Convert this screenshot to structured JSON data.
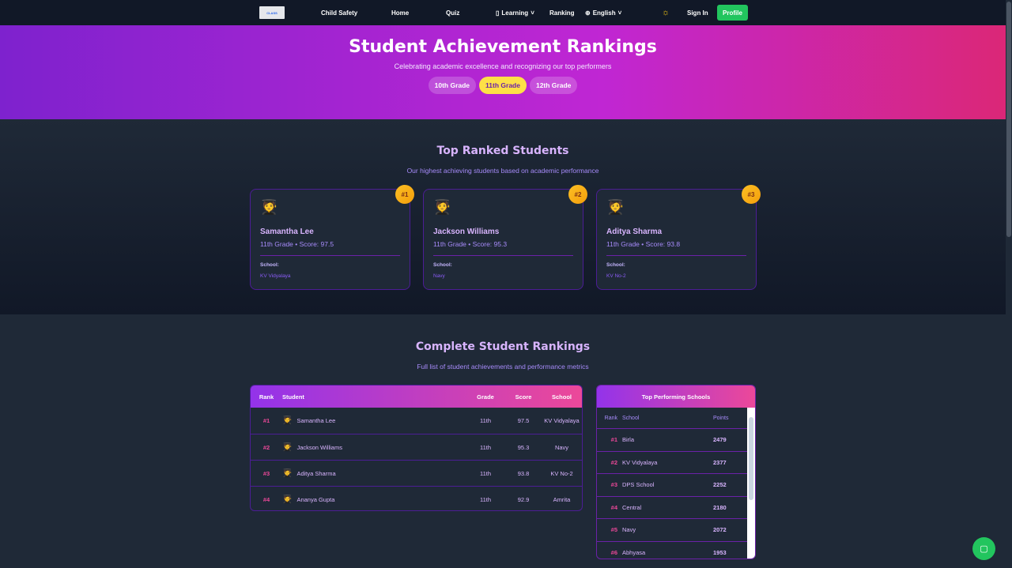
{
  "nav": {
    "logo_text": "CLASS",
    "items": [
      "Child Safety",
      "Home",
      "Quiz",
      "Learning",
      "Ranking",
      "English"
    ],
    "sign_in": "Sign In",
    "profile": "Profile"
  },
  "hero": {
    "title": "Student Achievement Rankings",
    "subtitle": "Celebrating academic excellence and recognizing our top performers",
    "grades": [
      "10th Grade",
      "11th Grade",
      "12th Grade"
    ],
    "active_grade": "11th Grade"
  },
  "top": {
    "title": "Top Ranked Students",
    "subtitle": "Our highest achieving students based on academic performance",
    "school_label": "School:",
    "cards": [
      {
        "rank": "#1",
        "emoji": "🧑‍🎓",
        "name": "Samantha Lee",
        "detail": "11th Grade • Score: 97.5",
        "school": "KV Vidyalaya"
      },
      {
        "rank": "#2",
        "emoji": "🧑‍🎓",
        "name": "Jackson Williams",
        "detail": "11th Grade • Score: 95.3",
        "school": "Navy"
      },
      {
        "rank": "#3",
        "emoji": "🧑‍🎓",
        "name": "Aditya Sharma",
        "detail": "11th Grade • Score: 93.8",
        "school": "KV No-2"
      }
    ]
  },
  "complete": {
    "title": "Complete Student Rankings",
    "subtitle": "Full list of student achievements and performance metrics",
    "headers": {
      "rank": "Rank",
      "student": "Student",
      "grade": "Grade",
      "score": "Score",
      "school": "School"
    },
    "rows": [
      {
        "rank": "#1",
        "name": "Samantha Lee",
        "grade": "11th",
        "score": "97.5",
        "school": "KV Vidyalaya"
      },
      {
        "rank": "#2",
        "name": "Jackson Williams",
        "grade": "11th",
        "score": "95.3",
        "school": "Navy"
      },
      {
        "rank": "#3",
        "name": "Aditya Sharma",
        "grade": "11th",
        "score": "93.8",
        "school": "KV No-2"
      },
      {
        "rank": "#4",
        "name": "Ananya Gupta",
        "grade": "11th",
        "score": "92.9",
        "school": "Amrita"
      }
    ]
  },
  "schools": {
    "title": "Top Performing Schools",
    "headers": {
      "rank": "Rank",
      "school": "School",
      "points": "Points"
    },
    "rows": [
      {
        "rank": "#1",
        "school": "Birla",
        "points": "2479"
      },
      {
        "rank": "#2",
        "school": "KV Vidyalaya",
        "points": "2377"
      },
      {
        "rank": "#3",
        "school": "DPS School",
        "points": "2252"
      },
      {
        "rank": "#4",
        "school": "Central",
        "points": "2180"
      },
      {
        "rank": "#5",
        "school": "Navy",
        "points": "2072"
      },
      {
        "rank": "#6",
        "school": "Abhyasa",
        "points": "1953"
      }
    ]
  }
}
